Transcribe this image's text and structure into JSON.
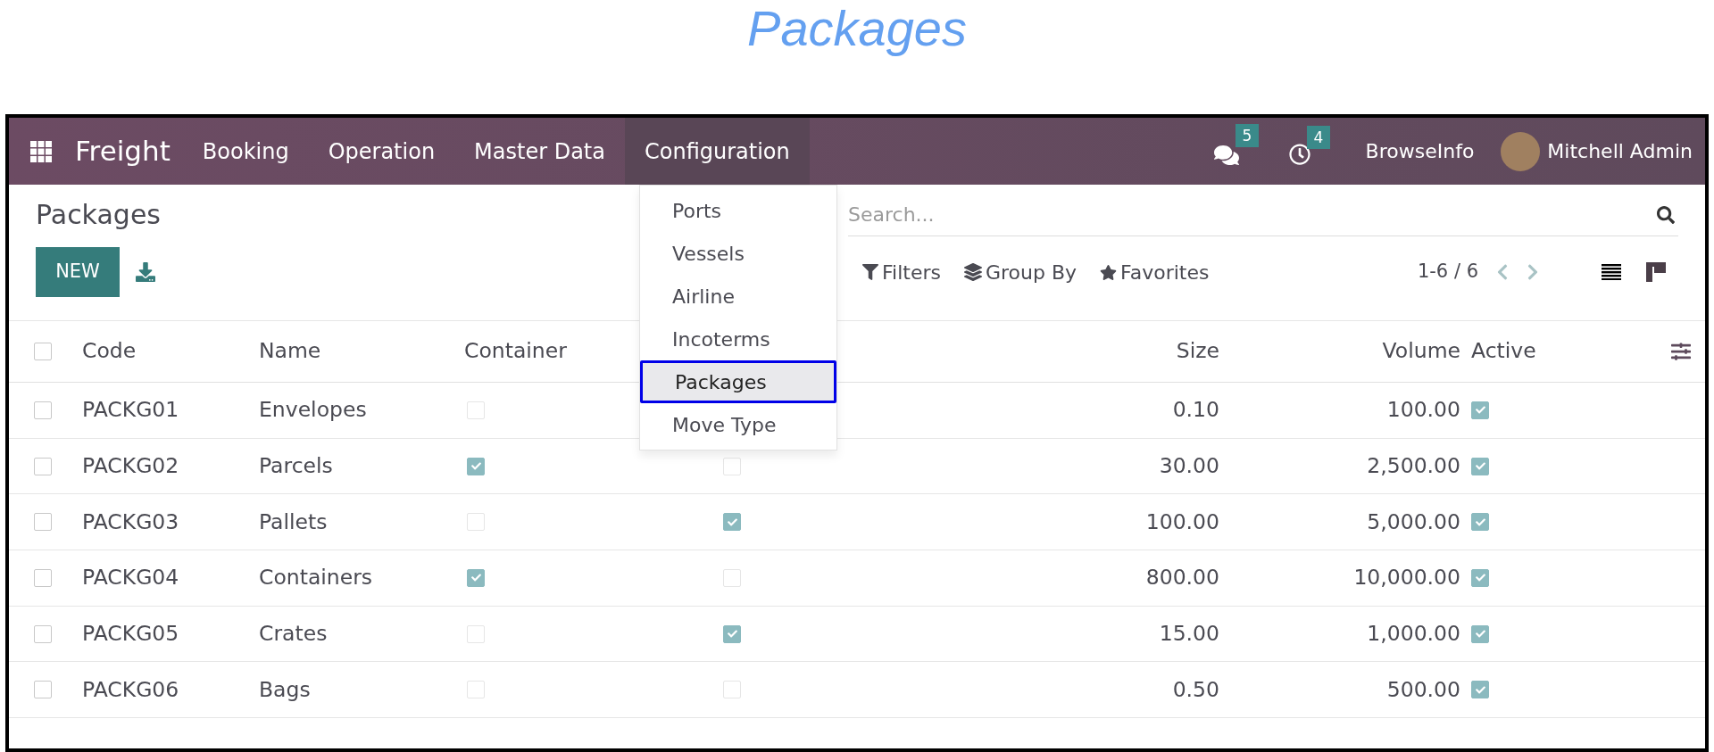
{
  "heading": "Packages",
  "navbar": {
    "app_name": "Freight",
    "menus": [
      {
        "label": "Booking",
        "open": false
      },
      {
        "label": "Operation",
        "open": false
      },
      {
        "label": "Master Data",
        "open": false
      },
      {
        "label": "Configuration",
        "open": true
      }
    ],
    "messages_count": "5",
    "activities_count": "4",
    "company": "BrowseInfo",
    "user": "Mitchell Admin"
  },
  "dropdown": {
    "items": [
      {
        "label": "Ports",
        "selected": false
      },
      {
        "label": "Vessels",
        "selected": false
      },
      {
        "label": "Airline",
        "selected": false
      },
      {
        "label": "Incoterms",
        "selected": false
      },
      {
        "label": "Packages",
        "selected": true
      },
      {
        "label": "Move Type",
        "selected": false
      }
    ]
  },
  "page_title": "Packages",
  "new_button": "NEW",
  "search": {
    "placeholder": "Search..."
  },
  "search_options": [
    {
      "kind": "filter",
      "label": "Filters"
    },
    {
      "kind": "group",
      "label": "Group By"
    },
    {
      "kind": "favorite",
      "label": "Favorites"
    }
  ],
  "pager": "1-6 / 6",
  "views": [
    {
      "kind": "list",
      "selected": true
    },
    {
      "kind": "kanban",
      "selected": false
    }
  ],
  "table": {
    "all_selected": false,
    "columns": [
      {
        "label": "Code"
      },
      {
        "label": "Name"
      },
      {
        "label": "Container"
      },
      {
        "label": "Size"
      },
      {
        "label": "Volume"
      },
      {
        "label": "Active"
      }
    ],
    "rows": [
      {
        "selected": false,
        "code": "PACKG01",
        "name": "Envelopes",
        "container": false,
        "size": "0.10",
        "volume": "100.00",
        "active": true
      },
      {
        "selected": false,
        "code": "PACKG02",
        "name": "Parcels",
        "container": true,
        "column_4": false,
        "size": "30.00",
        "volume": "2,500.00",
        "active": true
      },
      {
        "selected": false,
        "code": "PACKG03",
        "name": "Pallets",
        "container": false,
        "column_4": true,
        "size": "100.00",
        "volume": "5,000.00",
        "active": true
      },
      {
        "selected": false,
        "code": "PACKG04",
        "name": "Containers",
        "container": true,
        "column_4": false,
        "size": "800.00",
        "volume": "10,000.00",
        "active": true
      },
      {
        "selected": false,
        "code": "PACKG05",
        "name": "Crates",
        "container": false,
        "column_4": true,
        "size": "15.00",
        "volume": "1,000.00",
        "active": true
      },
      {
        "selected": false,
        "code": "PACKG06",
        "name": "Bags",
        "container": false,
        "column_4": false,
        "size": "0.50",
        "volume": "500.00",
        "active": true
      }
    ]
  }
}
